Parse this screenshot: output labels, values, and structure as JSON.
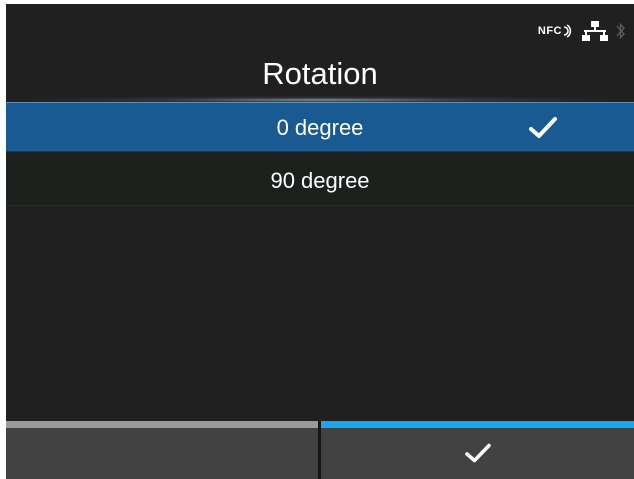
{
  "status_bar": {
    "nfc_label": "NFC",
    "icons": [
      "nfc-icon",
      "network-icon",
      "bluetooth-icon"
    ]
  },
  "screen": {
    "title": "Rotation"
  },
  "options": [
    {
      "label": "0 degree",
      "selected": true
    },
    {
      "label": "90 degree",
      "selected": false
    }
  ],
  "soft_keys": {
    "left": {
      "icon": "none",
      "color": "#9a9a9a"
    },
    "right": {
      "icon": "check-icon",
      "color": "#19a8ee"
    }
  },
  "colors": {
    "background": "#202020",
    "selected_row": "#1a5a92",
    "accent": "#19a8ee"
  }
}
